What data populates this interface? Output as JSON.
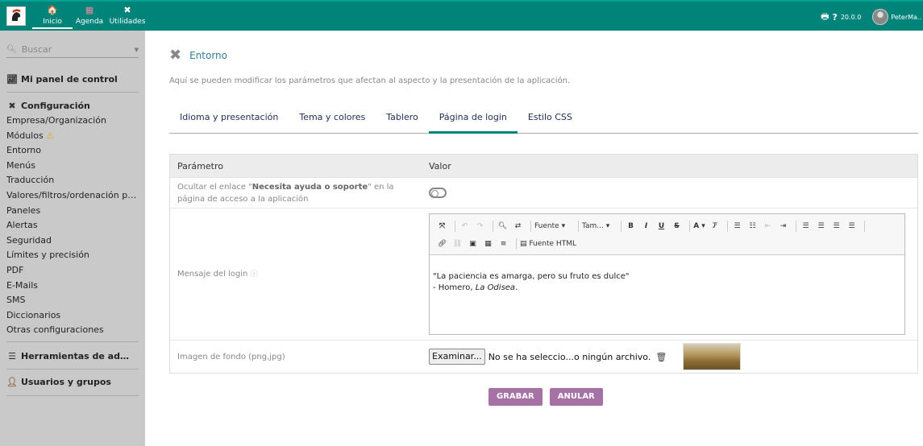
{
  "topbar": {
    "menu": [
      {
        "label": "Inicio",
        "icon": "home-icon",
        "glyph": "🏠"
      },
      {
        "label": "Agenda",
        "icon": "calendar-icon",
        "glyph": "▦"
      },
      {
        "label": "Utilidades",
        "icon": "tools-icon",
        "glyph": "✖"
      }
    ],
    "version": "20.0.0",
    "user": "PeterMa..",
    "print_glyph": "🖶",
    "help_glyph": "?",
    "accent": "#00847a"
  },
  "sidebar": {
    "search_placeholder": "Buscar",
    "dashboard": "Mi panel de control",
    "config_title": "Configuración",
    "config_items": [
      "Empresa/Organización",
      "Módulos",
      "Entorno",
      "Menús",
      "Traducción",
      "Valores/filtros/ordenación por defecto",
      "Paneles",
      "Alertas",
      "Seguridad",
      "Límites y precisión",
      "PDF",
      "E-Mails",
      "SMS",
      "Diccionarios",
      "Otras configuraciones"
    ],
    "tools_title": "Herramientas de administración",
    "users_title": "Usuarios y grupos"
  },
  "page": {
    "title": "Entorno",
    "description": "Aquí se pueden modificar los parámetros que afectan al aspecto y la presentación de la aplicación."
  },
  "tabs": [
    "Idioma y presentación",
    "Tema y colores",
    "Tablero",
    "Página de login",
    "Estilo CSS"
  ],
  "active_tab": "Página de login",
  "table": {
    "headers": {
      "param": "Parámetro",
      "value": "Valor"
    },
    "row1": {
      "pre": "Ocultar el enlace \"",
      "bold": "Necesita ayuda o soporte",
      "post": "\" en la página de acceso a la aplicación",
      "toggle_on": false
    },
    "row2": {
      "label": "Mensaje del login",
      "toolbar": {
        "font": "Fuente",
        "size": "Tam...",
        "html_source": "Fuente HTML"
      },
      "message_line1": "\"La paciencia es amarga, pero su fruto es dulce\"",
      "message_line2_prefix": "- Homero, ",
      "message_line2_italic": "La Odisea",
      "message_line2_suffix": "."
    },
    "row3": {
      "label": "Imagen de fondo (png,jpg)",
      "browse": "Examinar...",
      "no_file": "No se ha selecciо...o ningún archivo."
    }
  },
  "buttons": {
    "save": "GRABAR",
    "cancel": "ANULAR"
  }
}
